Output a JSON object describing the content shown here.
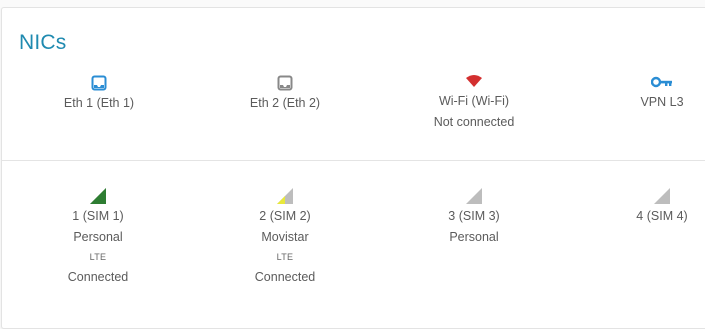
{
  "panel": {
    "title": "NICs"
  },
  "colors": {
    "accent": "#1f8ab0",
    "eth1_icon": "#2a8dd4",
    "eth2_icon": "#888888",
    "wifi_icon": "#d32f2f",
    "vpn_icon": "#2a8dd4",
    "signal_full": "#2e7d32",
    "signal_partial": "#e8e83a",
    "signal_empty": "#bdbdbd"
  },
  "nics_top": [
    {
      "icon": "ethernet-icon",
      "label": "Eth 1 (Eth 1)"
    },
    {
      "icon": "ethernet-icon",
      "label": "Eth 2 (Eth 2)"
    },
    {
      "icon": "wifi-icon",
      "label": "Wi-Fi (Wi-Fi)",
      "status": "Not connected"
    },
    {
      "icon": "key-icon",
      "label": "VPN L3"
    }
  ],
  "sims": [
    {
      "icon": "signal-icon",
      "signal_level": 1.0,
      "label": "1 (SIM 1)",
      "operator": "Personal",
      "tech": "LTE",
      "status": "Connected"
    },
    {
      "icon": "signal-icon",
      "signal_level": 0.5,
      "label": "2 (SIM 2)",
      "operator": "Movistar",
      "tech": "LTE",
      "status": "Connected"
    },
    {
      "icon": "signal-icon",
      "signal_level": 0,
      "label": "3 (SIM 3)",
      "operator": "Personal"
    },
    {
      "icon": "signal-icon",
      "signal_level": 0,
      "label": "4 (SIM 4)"
    }
  ]
}
